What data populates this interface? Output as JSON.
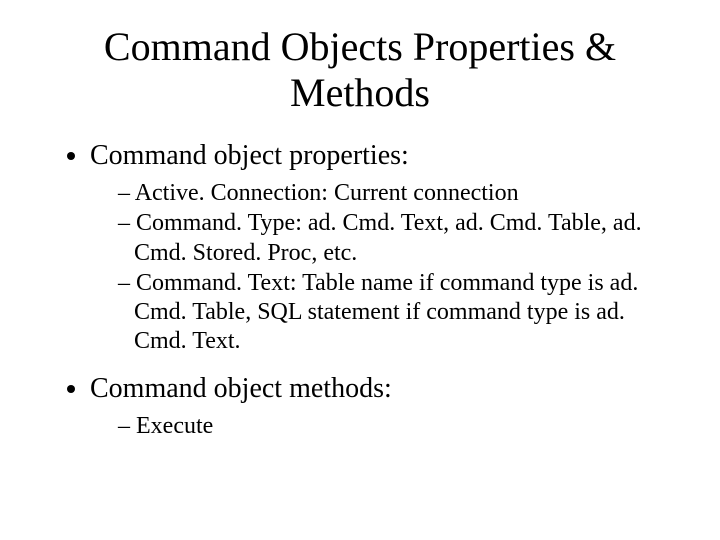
{
  "title": "Command Objects Properties & Methods",
  "bullets": [
    {
      "text": "Command object properties:",
      "sub": [
        "Active. Connection: Current connection",
        "Command. Type: ad. Cmd. Text, ad. Cmd. Table, ad. Cmd. Stored. Proc, etc.",
        "Command. Text: Table name if command type is ad. Cmd. Table, SQL statement if command type is ad. Cmd. Text."
      ]
    },
    {
      "text": "Command object methods:",
      "sub": [
        "Execute"
      ]
    }
  ]
}
